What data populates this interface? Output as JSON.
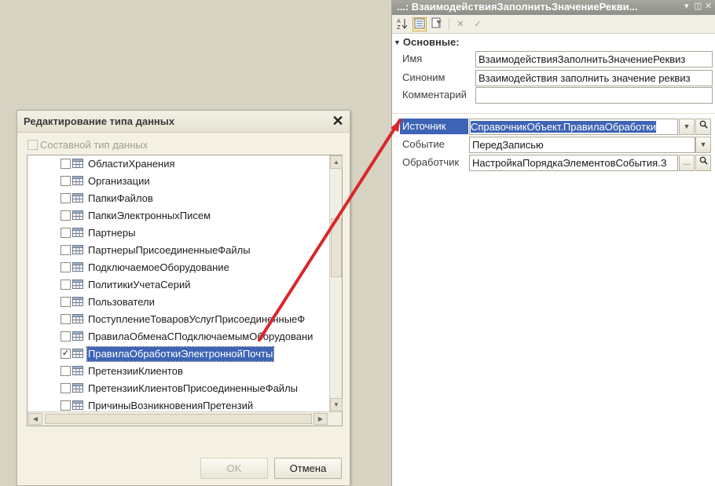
{
  "dialog": {
    "title": "Редактирование типа данных",
    "composite_label": "Составной тип данных",
    "items": [
      {
        "label": "ОбластиХранения",
        "checked": false,
        "selected": false
      },
      {
        "label": "Организации",
        "checked": false,
        "selected": false
      },
      {
        "label": "ПапкиФайлов",
        "checked": false,
        "selected": false
      },
      {
        "label": "ПапкиЭлектронныхПисем",
        "checked": false,
        "selected": false
      },
      {
        "label": "Партнеры",
        "checked": false,
        "selected": false
      },
      {
        "label": "ПартнерыПрисоединенныеФайлы",
        "checked": false,
        "selected": false
      },
      {
        "label": "ПодключаемоеОборудование",
        "checked": false,
        "selected": false
      },
      {
        "label": "ПолитикиУчетаСерий",
        "checked": false,
        "selected": false
      },
      {
        "label": "Пользователи",
        "checked": false,
        "selected": false
      },
      {
        "label": "ПоступлениеТоваровУслугПрисоединенныеФ",
        "checked": false,
        "selected": false
      },
      {
        "label": "ПравилаОбменаСПодключаемымОборудовани",
        "checked": false,
        "selected": false
      },
      {
        "label": "ПравилаОбработкиЭлектроннойПочты",
        "checked": true,
        "selected": true
      },
      {
        "label": "ПретензииКлиентов",
        "checked": false,
        "selected": false
      },
      {
        "label": "ПретензииКлиентовПрисоединенныеФайлы",
        "checked": false,
        "selected": false
      },
      {
        "label": "ПричиныВозникновенияПретензий",
        "checked": false,
        "selected": false
      }
    ],
    "ok_label": "OK",
    "cancel_label": "Отмена"
  },
  "properties": {
    "title": "...: ВзаимодействияЗаполнитьЗначениеРекви...",
    "section": "Основные:",
    "fields": {
      "name_label": "Имя",
      "name_value": "ВзаимодействияЗаполнитьЗначениеРеквиз",
      "synonym_label": "Синоним",
      "synonym_value": "Взаимодействия заполнить значение реквиз",
      "comment_label": "Комментарий",
      "comment_value": "",
      "source_label": "Источник",
      "source_value": "СправочникОбъект.ПравилаОбработки",
      "event_label": "Событие",
      "event_value": "ПередЗаписью",
      "handler_label": "Обработчик",
      "handler_value": "НастройкаПорядкаЭлементовСобытия.З"
    }
  },
  "colors": {
    "selection": "#3e64b5",
    "arrow": "#d9272c"
  }
}
